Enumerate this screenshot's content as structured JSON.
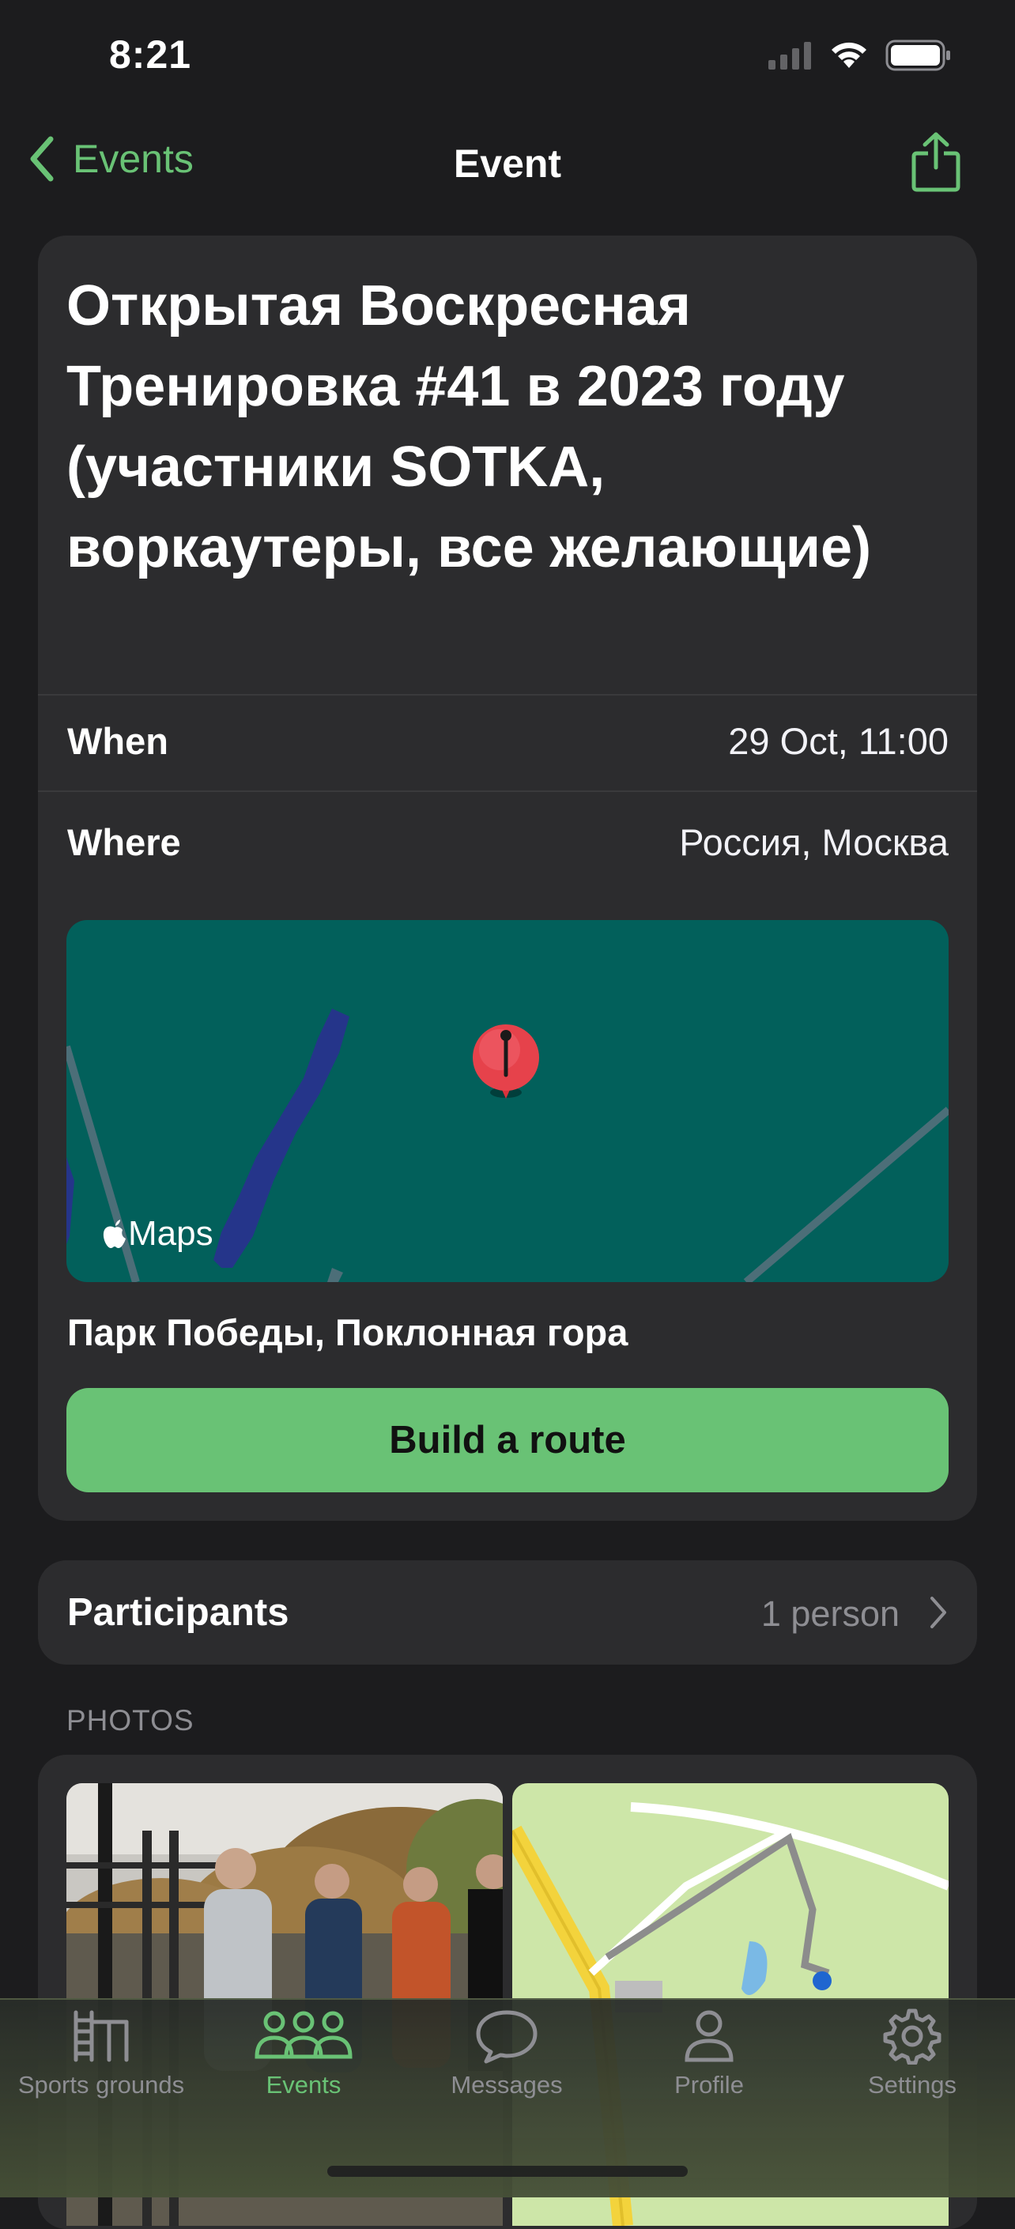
{
  "status_bar": {
    "time": "8:21"
  },
  "nav": {
    "back_label": "Events",
    "title": "Event"
  },
  "event": {
    "title": "Открытая Воскресная Тренировка #41 в 2023 году (участники SOTKA, воркаутеры, все желающие)",
    "when_label": "When",
    "when_value": "29 Oct, 11:00",
    "where_label": "Where",
    "where_value": "Россия, Москва",
    "map_attribution": "Maps",
    "place_name": "Парк Победы, Поклонная гора",
    "route_button": "Build a route"
  },
  "participants": {
    "label": "Participants",
    "value": "1 person"
  },
  "photos": {
    "header": "PHOTOS"
  },
  "tabbar": {
    "items": [
      {
        "label": "Sports grounds",
        "icon": "sports-grounds-icon",
        "active": false
      },
      {
        "label": "Events",
        "icon": "people-icon",
        "active": true
      },
      {
        "label": "Messages",
        "icon": "message-bubble-icon",
        "active": false
      },
      {
        "label": "Profile",
        "icon": "person-icon",
        "active": false
      },
      {
        "label": "Settings",
        "icon": "gear-icon",
        "active": false
      }
    ]
  },
  "colors": {
    "accent": "#69c275",
    "background": "#1c1c1e",
    "card": "#2c2c2e",
    "map_bg": "#02605b"
  }
}
